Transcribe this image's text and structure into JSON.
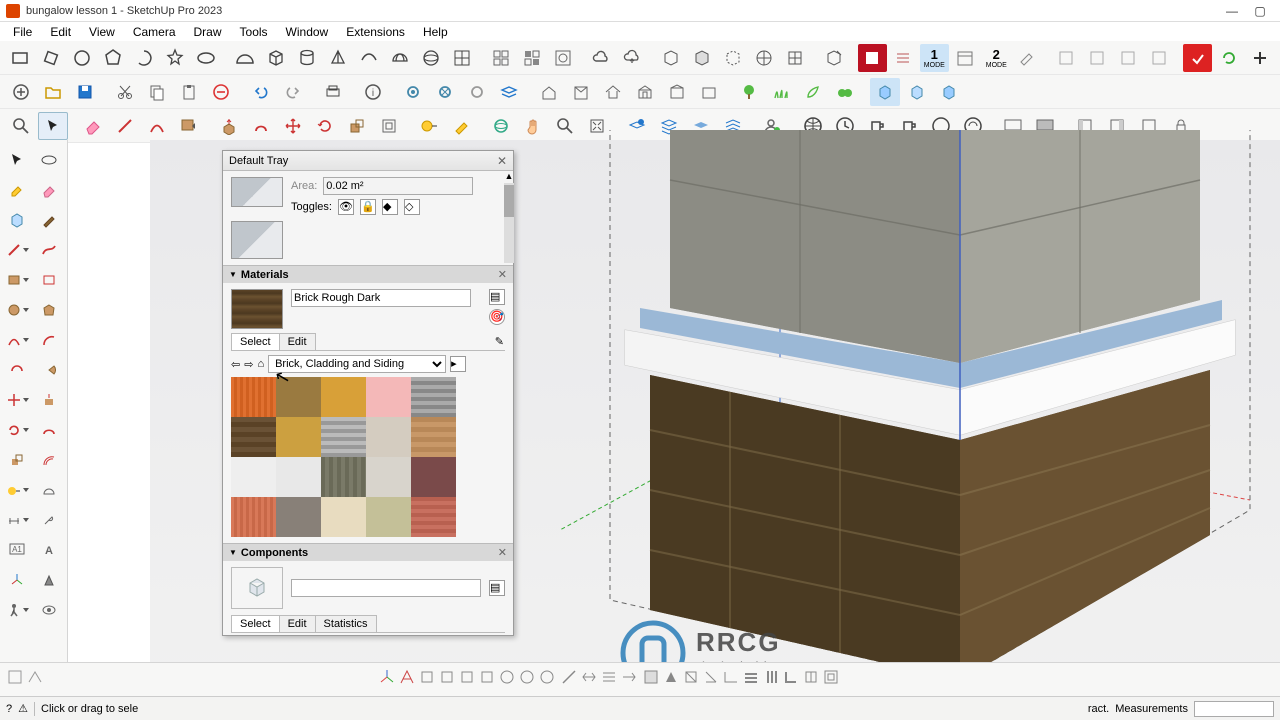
{
  "window": {
    "title": "bungalow lesson 1 - SketchUp Pro 2023"
  },
  "menu": [
    "File",
    "Edit",
    "View",
    "Camera",
    "Draw",
    "Tools",
    "Window",
    "Extensions",
    "Help"
  ],
  "status": {
    "hint": "Click or drag to sele",
    "right": "ract.",
    "measurements_label": "Measurements"
  },
  "tray": {
    "title": "Default Tray",
    "entity": {
      "areaLabel": "Area:",
      "areaValue": "0.02 m²",
      "togglesLabel": "Toggles:"
    },
    "materials": {
      "panel": "Materials",
      "name": "Brick Rough Dark",
      "tab_select": "Select",
      "tab_edit": "Edit",
      "library": "Brick, Cladding and Siding"
    },
    "components": {
      "panel": "Components",
      "tab_select": "Select",
      "tab_edit": "Edit",
      "tab_stats": "Statistics"
    }
  },
  "mode": {
    "one": "1",
    "one_label": "MODE",
    "two": "2",
    "two_label": "MODE"
  },
  "watermark": {
    "brand": "RRCG",
    "sub": "人人素材"
  }
}
